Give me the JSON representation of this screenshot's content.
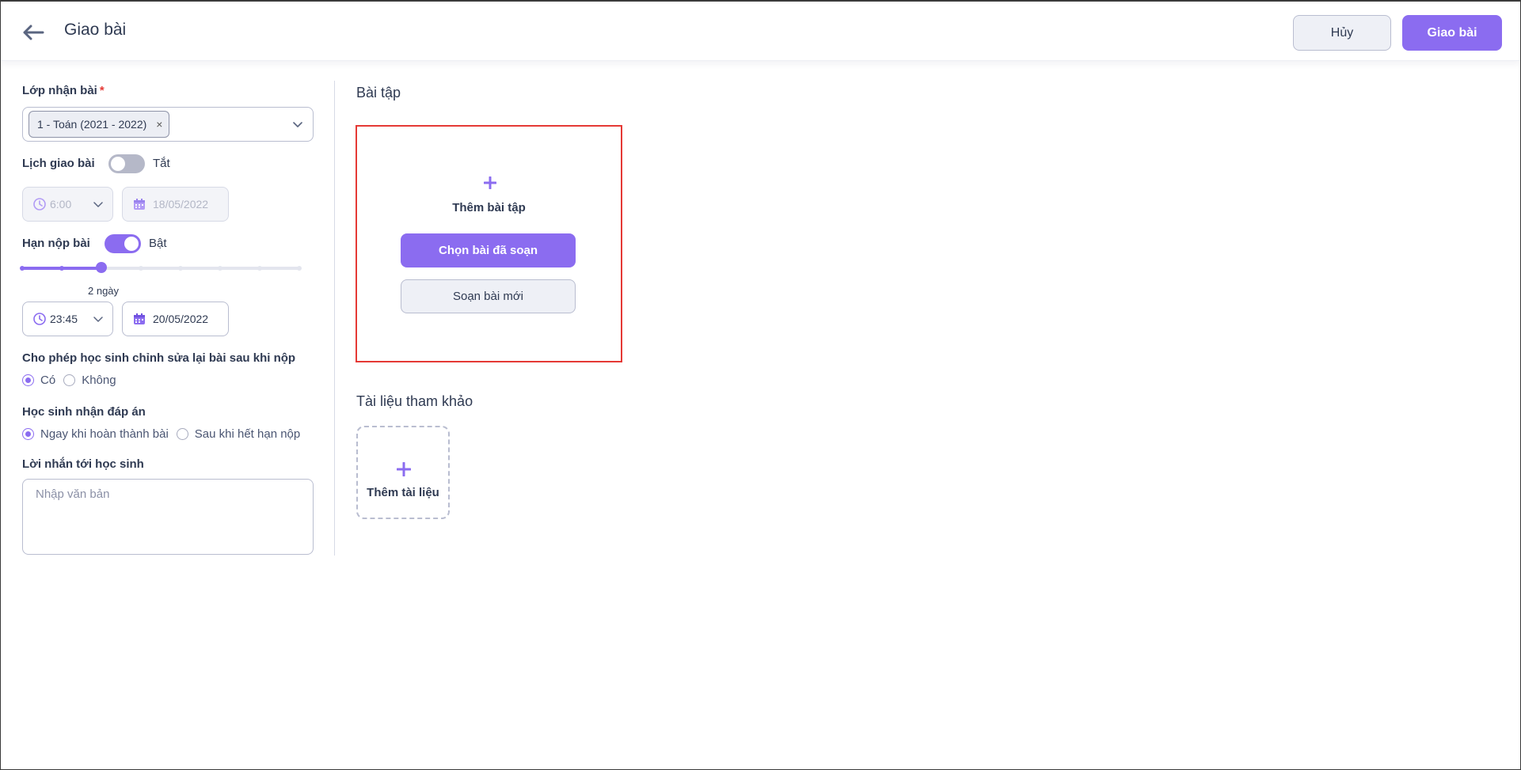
{
  "header": {
    "title": "Giao bài",
    "cancel_label": "Hủy",
    "submit_label": "Giao bài"
  },
  "form": {
    "class_label": "Lớp nhận bài",
    "required_mark": "*",
    "selected_class": "1 - Toán (2021 - 2022)",
    "chip_remove": "×",
    "schedule": {
      "label": "Lịch giao bài",
      "state_text": "Tắt",
      "enabled": false,
      "time": "6:00",
      "date": "18/05/2022"
    },
    "deadline": {
      "label": "Hạn nộp bài",
      "state_text": "Bật",
      "enabled": true,
      "slider_value_label": "2 ngày",
      "slider_steps": 8,
      "slider_index": 2,
      "time": "23:45",
      "date": "20/05/2022"
    },
    "allow_edit": {
      "label": "Cho phép học sinh chỉnh sửa lại bài sau khi nộp",
      "options": [
        "Có",
        "Không"
      ],
      "selected": "Có"
    },
    "answer_release": {
      "label": "Học sinh nhận đáp án",
      "options": [
        "Ngay khi hoàn thành bài",
        "Sau khi hết hạn nộp"
      ],
      "selected": "Ngay khi hoàn thành bài"
    },
    "message": {
      "label": "Lời nhắn tới học sinh",
      "placeholder": "Nhập văn bản",
      "value": ""
    }
  },
  "exercises": {
    "section_title": "Bài tập",
    "add_label": "Thêm bài tập",
    "choose_existing_label": "Chọn bài đã soạn",
    "create_new_label": "Soạn bài mới"
  },
  "references": {
    "section_title": "Tài liệu tham khảo",
    "add_label": "Thêm tài liệu"
  },
  "icons": {
    "back": "arrow-left-icon",
    "clock": "clock-icon",
    "calendar": "calendar-icon",
    "caret": "chevron-down-icon",
    "plus": "plus-icon"
  },
  "colors": {
    "accent": "#8b6cf0",
    "highlight_border": "#e53935"
  }
}
